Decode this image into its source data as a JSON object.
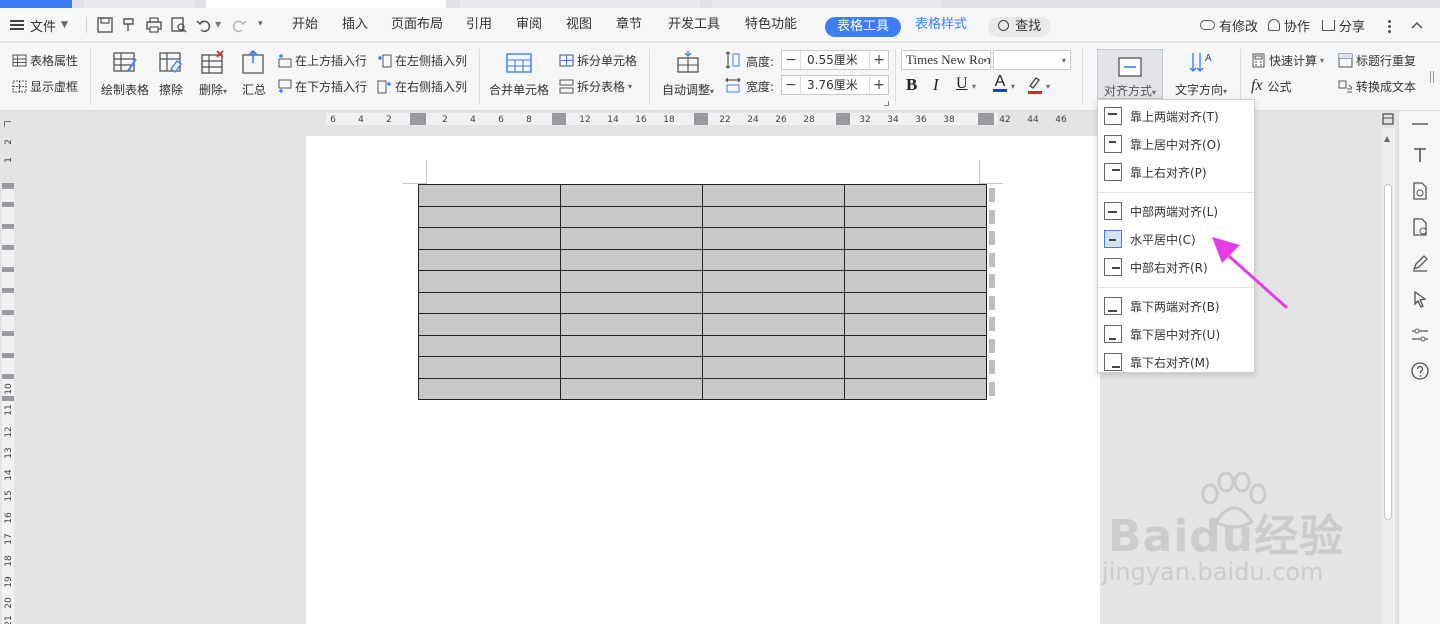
{
  "menubar": {
    "file_menu": "文件",
    "tabs": [
      "开始",
      "插入",
      "页面布局",
      "引用",
      "审阅",
      "视图",
      "章节",
      "开发工具",
      "特色功能"
    ],
    "active_tab": "表格工具",
    "table_style_tab": "表格样式",
    "search": "查找",
    "modified": "有修改",
    "collaborate": "协作",
    "share": "分享"
  },
  "ribbon": {
    "table_props": "表格属性",
    "show_grid": "显示虚框",
    "draw_table": "绘制表格",
    "erase": "擦除",
    "delete": "删除",
    "summary": "汇总",
    "insert_row_above": "在上方插入行",
    "insert_row_below": "在下方插入行",
    "insert_col_left": "在左侧插入列",
    "insert_col_right": "在右侧插入列",
    "merge_cells": "合并单元格",
    "split_cells": "拆分单元格",
    "split_table": "拆分表格",
    "auto_fit": "自动调整",
    "height_label": "高度:",
    "height_value": "0.55厘米",
    "width_label": "宽度:",
    "width_value": "3.76厘米",
    "minus": "−",
    "plus": "+",
    "font_name": "Times New Roman",
    "bold": "B",
    "italic": "I",
    "underline": "U",
    "font_color": "A",
    "align": "对齐方式",
    "text_direction": "文字方向",
    "quick_calc": "快速计算",
    "repeat_header": "标题行重复",
    "formula_fx": "fx",
    "formula": "公式",
    "convert_text": "转换成文本"
  },
  "ruler": {
    "h_ticks": [
      "6",
      "4",
      "2",
      "2",
      "4",
      "6",
      "8",
      "12",
      "14",
      "16",
      "18",
      "22",
      "24",
      "26",
      "28",
      "32",
      "34",
      "36",
      "38",
      "42",
      "44",
      "46"
    ],
    "v_ticks": [
      "2",
      "1",
      "10",
      "11",
      "12",
      "13",
      "14",
      "15",
      "16",
      "17",
      "18",
      "19",
      "20",
      "21"
    ]
  },
  "table": {
    "rows": 10,
    "cols": 4
  },
  "dropdown": {
    "groups": [
      [
        {
          "label": "靠上两端对齐(T)"
        },
        {
          "label": "靠上居中对齐(O)"
        },
        {
          "label": "靠上右对齐(P)"
        }
      ],
      [
        {
          "label": "中部两端对齐(L)"
        },
        {
          "label": "水平居中(C)",
          "selected": true
        },
        {
          "label": "中部右对齐(R)"
        }
      ],
      [
        {
          "label": "靠下两端对齐(B)"
        },
        {
          "label": "靠下居中对齐(U)"
        },
        {
          "label": "靠下右对齐(M)"
        }
      ]
    ]
  },
  "watermark": {
    "brand": "Baidu经验",
    "url": "jingyan.baidu.com"
  },
  "colors": {
    "accent": "#3d7ef5",
    "arrow": "#e63ce6",
    "table_fill": "#c8c8c8",
    "underline_red": "#d9262b",
    "font_blue": "#1b3fd4"
  }
}
